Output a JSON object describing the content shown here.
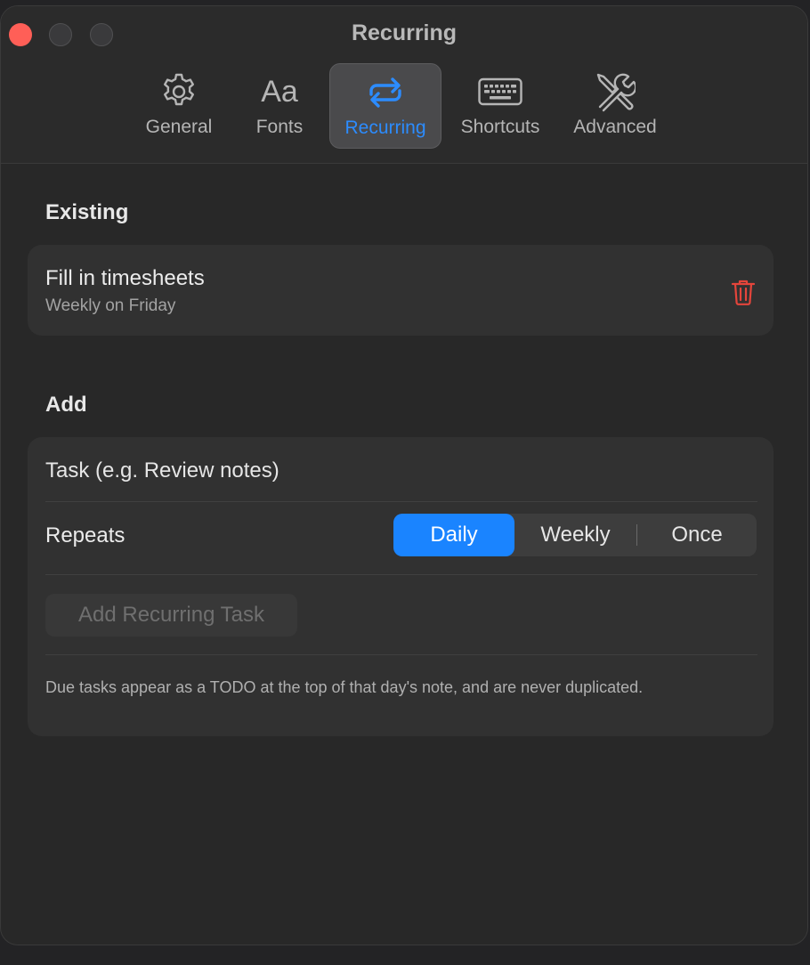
{
  "window": {
    "title": "Recurring"
  },
  "tabs": [
    {
      "label": "General",
      "icon": "gear-icon",
      "active": false
    },
    {
      "label": "Fonts",
      "icon": "font-icon",
      "glyph": "Aa",
      "active": false
    },
    {
      "label": "Recurring",
      "icon": "repeat-icon",
      "active": true
    },
    {
      "label": "Shortcuts",
      "icon": "keyboard-icon",
      "active": false
    },
    {
      "label": "Advanced",
      "icon": "tools-icon",
      "active": false
    }
  ],
  "existing": {
    "heading": "Existing",
    "tasks": [
      {
        "title": "Fill in timesheets",
        "schedule": "Weekly on Friday",
        "delete_icon": "trash-icon"
      }
    ]
  },
  "add": {
    "heading": "Add",
    "task_placeholder": "Task (e.g. Review notes)",
    "task_value": "",
    "repeats_label": "Repeats",
    "repeat_options": [
      "Daily",
      "Weekly",
      "Once"
    ],
    "repeat_selected": "Daily",
    "submit_label": "Add Recurring Task",
    "note": "Due tasks appear as a TODO at the top of that day's note, and are never duplicated."
  },
  "colors": {
    "accent": "#1a84ff",
    "accent_text": "#2c8cff",
    "danger": "#e5453b",
    "close_button": "#ff5f57",
    "window_bg": "#282828",
    "card_bg": "#313131"
  }
}
